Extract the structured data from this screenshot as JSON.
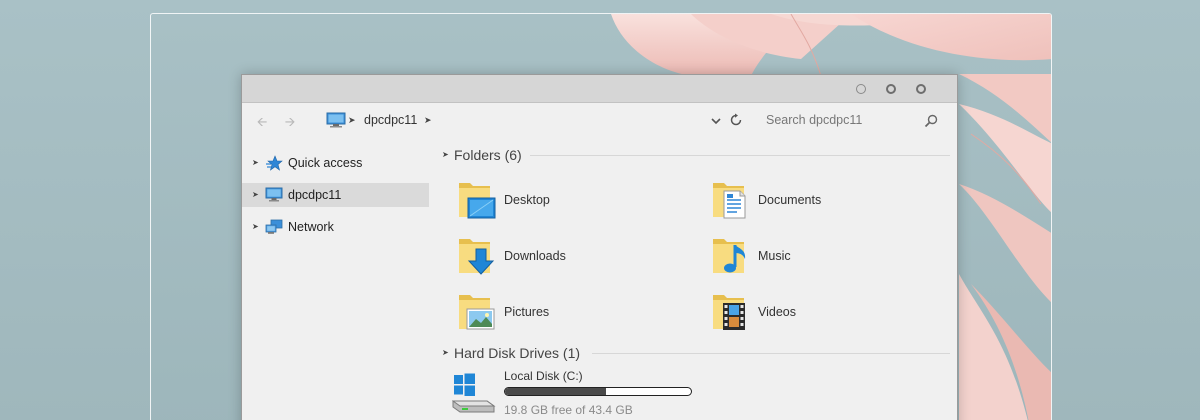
{
  "window": {
    "buttons": {
      "minimize": "minimize",
      "maximize": "maximize",
      "close": "close"
    }
  },
  "navbar": {
    "back_icon": "arrow-left-icon",
    "forward_icon": "arrow-right-icon",
    "breadcrumb": {
      "icon": "computer-icon",
      "label": "dpcdpc11"
    },
    "search": {
      "placeholder": "Search dpcdpc11",
      "value": ""
    }
  },
  "sidebar": {
    "items": [
      {
        "label": "Quick access",
        "icon": "star-icon",
        "selected": false
      },
      {
        "label": "dpcdpc11",
        "icon": "computer-icon",
        "selected": true
      },
      {
        "label": "Network",
        "icon": "network-icon",
        "selected": false
      }
    ]
  },
  "content": {
    "folders": {
      "title": "Folders (6)",
      "items": [
        {
          "label": "Desktop",
          "icon": "desktop-folder-icon"
        },
        {
          "label": "Documents",
          "icon": "documents-folder-icon"
        },
        {
          "label": "Downloads",
          "icon": "downloads-folder-icon"
        },
        {
          "label": "Music",
          "icon": "music-folder-icon"
        },
        {
          "label": "Pictures",
          "icon": "pictures-folder-icon"
        },
        {
          "label": "Videos",
          "icon": "videos-folder-icon"
        }
      ]
    },
    "drives": {
      "title": "Hard Disk Drives (1)",
      "items": [
        {
          "name": "Local Disk (C:)",
          "free_text": "19.8 GB free of 43.4 GB",
          "used_fraction": 0.544,
          "icon": "hard-drive-icon"
        }
      ]
    }
  },
  "colors": {
    "folder": "#f5d36b",
    "accent_blue": "#1f86d6",
    "window_bg": "#f0f0f0",
    "selected_bg": "#dadada"
  }
}
